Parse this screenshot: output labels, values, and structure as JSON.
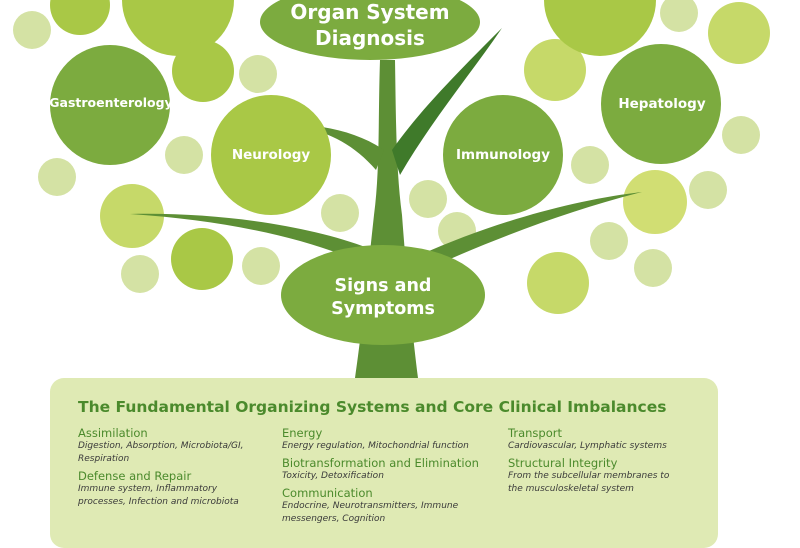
{
  "colors": {
    "dark_green": "#7cab3f",
    "light_green": "#a9c846",
    "pale_green": "#d4e2a4",
    "trunk": "#5d8f35",
    "panel_bg": "#dfeab4",
    "title_green": "#4b8a2c"
  },
  "tree": {
    "top_label_1": "Organ System",
    "top_label_2": "Diagnosis",
    "bottom_label_1": "Signs and",
    "bottom_label_2": "Symptoms",
    "gastro": "Gastroenterology",
    "neuro": "Neurology",
    "immuno": "Immunology",
    "hepato": "Hepatology"
  },
  "panel": {
    "title": "The Fundamental Organizing Systems and Core Clinical Imbalances",
    "col1": [
      {
        "head": "Assimilation",
        "desc": [
          "Digestion, Absorption, Microbiota/GI,",
          "Respiration"
        ]
      },
      {
        "head": "Defense and Repair",
        "desc": [
          "Immune system, Inflammatory",
          "processes, Infection and microbiota"
        ]
      }
    ],
    "col2": [
      {
        "head": "Energy",
        "desc": [
          "Energy regulation, Mitochondrial function"
        ]
      },
      {
        "head": "Biotransformation and Elimination",
        "desc": [
          "Toxicity, Detoxification"
        ]
      },
      {
        "head": "Communication",
        "desc": [
          "Endocrine, Neurotransmitters, Immune",
          "messengers, Cognition"
        ]
      }
    ],
    "col3": [
      {
        "head": "Transport",
        "desc": [
          "Cardiovascular, Lymphatic systems"
        ]
      },
      {
        "head": "Structural Integrity",
        "desc": [
          "From the subcellular membranes to",
          "the musculoskeletal system"
        ]
      }
    ]
  }
}
